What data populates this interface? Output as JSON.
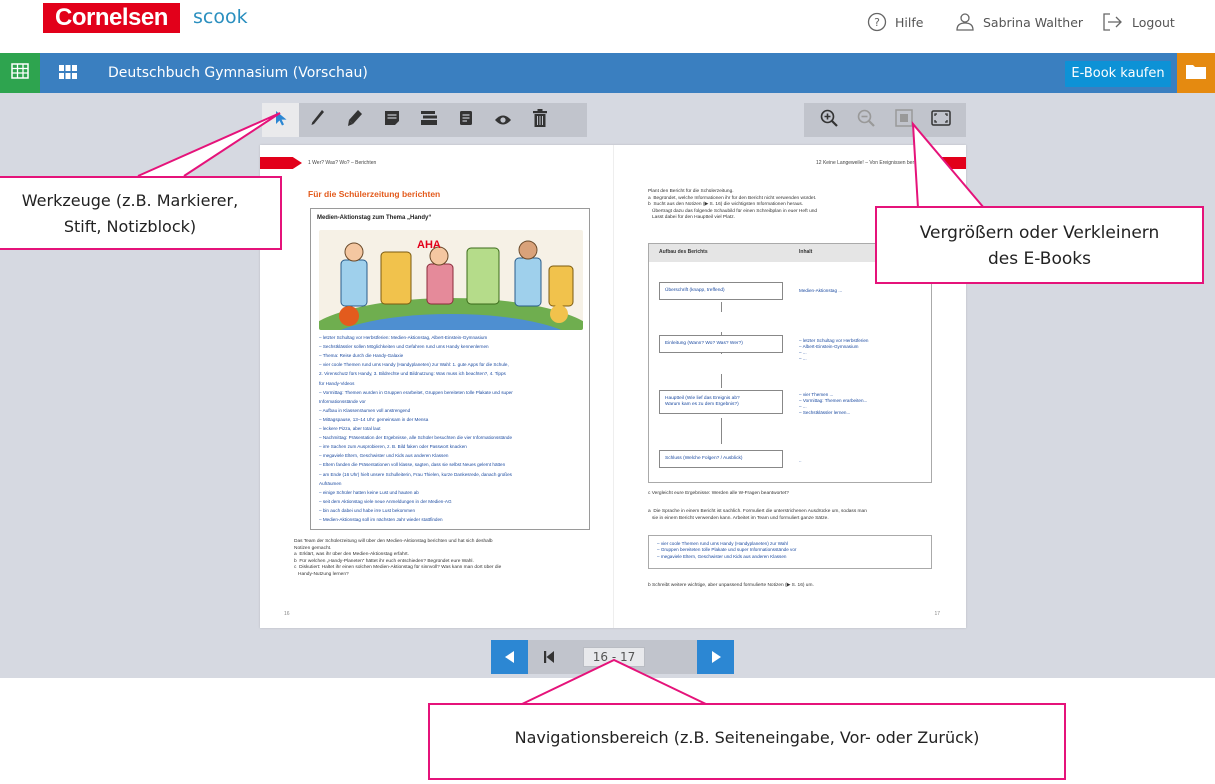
{
  "header": {
    "brand": "Cornelsen",
    "product": "scook",
    "help": "Hilfe",
    "user": "Sabrina Walther",
    "logout": "Logout"
  },
  "bar": {
    "title": "Deutschbuch Gymnasium  (Vorschau)",
    "buy_label": "E-Book kaufen"
  },
  "tools": {
    "left": [
      "pointer-icon",
      "pen-icon",
      "marker-icon",
      "note-icon",
      "cover-icon",
      "page-icon",
      "eye-icon",
      "trash-icon"
    ],
    "right": [
      "zoom-in-icon",
      "zoom-out-icon",
      "fit-page-icon",
      "fullscreen-icon"
    ]
  },
  "book": {
    "left_header": "1  Wer? Was? Wo? – Berichten",
    "right_header": "12  Keine Langeweile! – Von Ereignissen berichten",
    "section_title": "Für die Schülerzeitung berichten",
    "box_title": "Medien-Aktionstag zum Thema „Handy“",
    "bullets": [
      "– letzter Schultag vor Herbstferien: Medien-Aktionstag, Albert-Einstein-Gymnasium",
      "– Sechstklässler sollen Möglichkeiten und Gefahren rund ums Handy kennenlernen",
      "– Thema: Reise durch die Handy-Galaxie",
      "– vier coole Themen rund ums Handy (Handyplaneten) zur Wahl: 1. gute Apps für die Schule,",
      "   2. Virenschutz fürs Handy, 3. Bildrechte und Bildnutzung: Was muss ich beachten?, 4. Tipps",
      "   für Handy-Videos",
      "– Vormittag: Themen wurden in Gruppen erarbeitet, Gruppen bereiteten tolle Plakate und super",
      "   Informationsstände vor",
      "– Aufbau in Klassenräumen voll anstrengend",
      "– Mittagspause, 13–14 Uhr: gemeinsam in der Mensa",
      "– leckere Pizza, aber total laut",
      "– Nachmittag: Präsentation der Ergebnisse, alle Schüler besuchten die vier Informationsstände",
      "– irre Sachen zum Ausprobieren, z. B. Bild faken oder Passwort knacken",
      "– megaviele Eltern, Geschwister und Kids aus anderen Klassen",
      "– Eltern fanden die Präsentationen voll klasse, sagten, dass sie selbst Neues gelernt hätten",
      "– am Ende (16 Uhr) hielt unsere Schulleiterin, Frau Thielen, kurze Dankesrede, danach großes",
      "   Aufräumen",
      "– einige Schüler hatten keine Lust und hauten ab",
      "– seit dem Aktionstag viele neue Anmeldungen in der Medien-AG",
      "– bin auch dabei und habe irre Lust bekommen",
      "– Medien-Aktionstag soll im nächsten Jahr wieder stattfinden"
    ],
    "task1": [
      "Das Team der Schülerzeitung will über den Medien-Aktionstag berichten und hat sich deshalb",
      "Notizen gemacht.",
      "a  Erklärt, was ihr über den Medien-Aktionstag erfahrt.",
      "b  Für welchen „Handy-Planeten“ hättet ihr euch entschieden? Begründet eure Wahl.",
      "c  Diskutiert: Haltet ihr einen solchen Medien-Aktionstag für sinnvoll? Was kann man dort über die",
      "   Handy-Nutzung lernen?"
    ],
    "task2": [
      "Plant den Bericht für die Schülerzeitung.",
      "a  Begründet, welche Informationen ihr für den Bericht nicht verwenden würdet.",
      "b  Sucht aus den Notizen (▶ S. 16) die wichtigsten Informationen heraus.",
      "   Übertragt dazu das folgende Schaubild für einen Schreibplan in euer Heft und",
      "   Lasst dabei für den Hauptteil viel Platz."
    ],
    "diagram_head_left": "Aufbau des Berichts",
    "diagram_head_right": "Inhalt",
    "diagram_rows": [
      {
        "label": "Überschrift (knapp, treffend)",
        "content": "Medien-Aktionstag ..."
      },
      {
        "label": "Einleitung (Wann? Wo? Was? Wer?)",
        "content": "– letzter Schultag vor Herbstferien\n– Albert-Einstein-Gymnasium\n– ...\n– ..."
      },
      {
        "label": "Hauptteil (Wie lief das Ereignis ab?\nWarum kam es zu dem Ergebnis?)",
        "content": "– vier Themen ...\n– Vormittag: Themen erarbeiten...\n– ...\n– Sechstklässler lernen..."
      },
      {
        "label": "Schluss (Welche Folgen? / Ausblick)",
        "content": ".."
      }
    ],
    "task2c": "c  Vergleicht eure Ergebnisse: Werden alle W-Fragen beantwortet?",
    "task3": [
      "a  Die Sprache in einem Bericht ist sachlich. Formuliert die unterstrichenen Ausdrücke um, sodass man",
      "   sie in einem Bericht verwenden kann. Arbeitet im Team und formuliert ganze Sätze."
    ],
    "lang_box": [
      "– vier coole Themen rund ums Handy (Handyplaneten) zur Wahl",
      "– Gruppen bereiteten tolle Plakate und super Informationsstände vor",
      "– megaviele Eltern, Geschwister und Kids aus anderen Klassen"
    ],
    "task3b": "b  Schreibt weitere wichtige, aber unpassend formulierte Notizen (▶ S. 16) um.",
    "page_left": "16",
    "page_right": "17"
  },
  "nav": {
    "page_value": "16 - 17"
  },
  "callouts": {
    "tools": [
      "Werkzeuge (z.B. Markierer,",
      "Stift, Notizblock)"
    ],
    "zoom": [
      "Vergrößern oder Verkleinern",
      "des E-Books"
    ],
    "nav": "Navigationsbereich (z.B. Seiteneingabe, Vor- oder Zurück)"
  },
  "colors": {
    "brand_red": "#e2001a",
    "bar_blue": "#3a7fc0",
    "buy_blue": "#0d92d6",
    "accent_green": "#2ea44f",
    "orange": "#e58a10",
    "callout_pink": "#e5137a"
  }
}
